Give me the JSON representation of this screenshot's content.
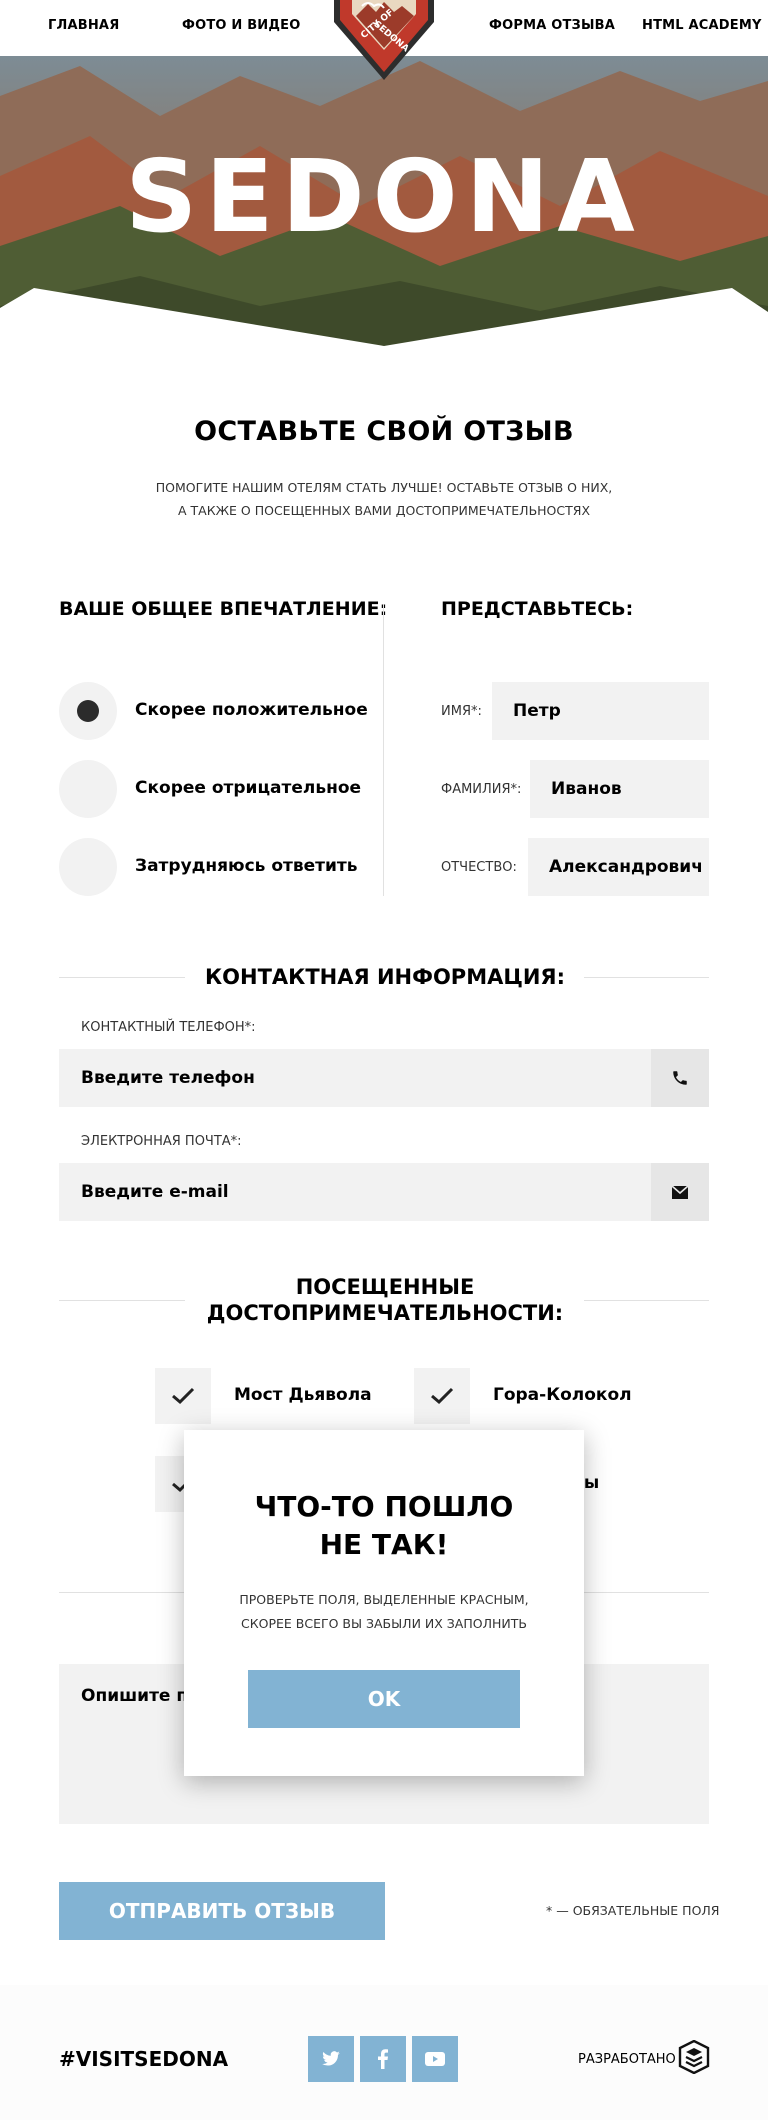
{
  "nav": {
    "items": [
      "ГЛАВНАЯ",
      "ФОТО И ВИДЕО",
      "ФОРМА ОТЗЫВА",
      "HTML ACADEMY"
    ],
    "logo_text": "CITY OF SEDONA"
  },
  "hero": {
    "title": "SEDONA"
  },
  "intro": {
    "title": "ОСТАВЬТЕ СВОЙ ОТЗЫВ",
    "text_line1": "ПОМОГИТЕ НАШИМ ОТЕЛЯМ СТАТЬ ЛУЧШЕ! ОСТАВЬТЕ ОТЗЫВ О НИХ,",
    "text_line2": "А ТАКЖЕ О ПОСЕЩЕННЫХ ВАМИ ДОСТОПРИМЕЧАТЕЛЬНОСТЯХ"
  },
  "impression": {
    "title": "ВАШЕ ОБЩЕЕ ВПЕЧАТЛЕНИЕ:",
    "options": [
      {
        "label": "Скорее положительное",
        "checked": true
      },
      {
        "label": "Скорее отрицательное",
        "checked": false
      },
      {
        "label": "Затрудняюсь ответить",
        "checked": false
      }
    ]
  },
  "person": {
    "title": "ПРЕДСТАВЬТЕСЬ:",
    "first_name": {
      "label": "ИМЯ*:",
      "value": "Петр"
    },
    "last_name": {
      "label": "ФАМИЛИЯ*:",
      "value": "Иванов"
    },
    "middle_name": {
      "label": "ОТЧЕСТВО:",
      "value": "Александрович"
    }
  },
  "contacts": {
    "title": "КОНТАКТНАЯ ИНФОРМАЦИЯ:",
    "phone_label": "КОНТАКТНЫЙ ТЕЛЕФОН*:",
    "phone_placeholder": "Введите телефон",
    "email_label": "ЭЛЕКТРОННАЯ ПОЧТА*:",
    "email_placeholder": "Введите e-mail"
  },
  "sights": {
    "title_line1": "ПОСЕЩЕННЫЕ",
    "title_line2": "ДОСТОПРИМЕЧАТЕЛЬНОСТИ:",
    "items": [
      {
        "label": "Мост Дьявола",
        "checked": true
      },
      {
        "label": "Гора-Колокол",
        "checked": true
      },
      {
        "label": "",
        "checked": true
      },
      {
        "label": "алы",
        "checked": false
      }
    ]
  },
  "comment": {
    "placeholder": "Опишите под"
  },
  "submit": {
    "label": "ОТПРАВИТЬ ОТЗЫВ",
    "required_note": "* — ОБЯЗАТЕЛЬНЫЕ ПОЛЯ"
  },
  "footer": {
    "hashtag": "#VISITSEDONA",
    "developed_by": "РАЗРАБОТАНО"
  },
  "modal": {
    "title_line1": "ЧТО-ТО ПОШЛО",
    "title_line2": "НЕ ТАК!",
    "text_line1": "ПРОВЕРЬТЕ ПОЛЯ, ВЫДЕЛЕННЫЕ КРАСНЫМ,",
    "text_line2": "СКОРЕЕ ВСЕГО ВЫ ЗАБЫЛИ ИХ ЗАПОЛНИТЬ",
    "ok_label": "OK"
  },
  "colors": {
    "accent": "#82b3d3",
    "field_bg": "#f2f2f2",
    "logo_red": "#c0392b"
  }
}
